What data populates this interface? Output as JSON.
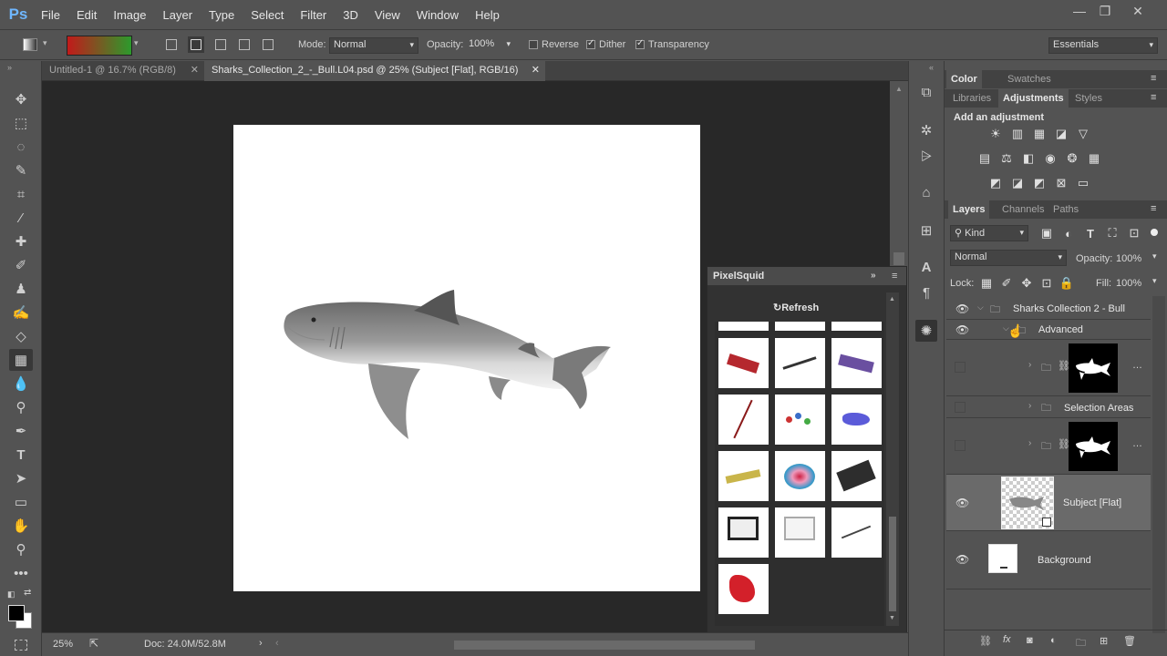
{
  "app": {
    "logo": "Ps",
    "menu": [
      "File",
      "Edit",
      "Image",
      "Layer",
      "Type",
      "Select",
      "Filter",
      "3D",
      "View",
      "Window",
      "Help"
    ],
    "window_controls": [
      "—",
      "❐",
      "✕"
    ]
  },
  "options_bar": {
    "mode_label": "Mode:",
    "mode_value": "Normal",
    "opacity_label": "Opacity:",
    "opacity_value": "100%",
    "reverse_label": "Reverse",
    "reverse_checked": false,
    "dither_label": "Dither",
    "dither_checked": true,
    "transparency_label": "Transparency",
    "transparency_checked": true,
    "workspace_value": "Essentials",
    "gradient_colors": [
      "#c21a1a",
      "#2c9a2c"
    ]
  },
  "tabs": [
    {
      "label": "Untitled-1 @ 16.7% (RGB/8)",
      "active": false
    },
    {
      "label": "Sharks_Collection_2_-_Bull.L04.psd @ 25% (Subject [Flat], RGB/16)",
      "active": true
    }
  ],
  "status": {
    "zoom": "25%",
    "doc": "Doc: 24.0M/52.8M"
  },
  "pixelsquid": {
    "title": "PixelSquid",
    "refresh_label": "Refresh"
  },
  "right_panels": {
    "top_tabs": [
      "Color",
      "Swatches"
    ],
    "mid_tabs": [
      "Libraries",
      "Adjustments",
      "Styles"
    ],
    "adjustment_hint": "Add an adjustment",
    "layer_tabs": [
      "Layers",
      "Channels",
      "Paths"
    ],
    "filter_kind": "Kind",
    "blend_mode": "Normal",
    "opacity_label": "Opacity:",
    "opacity_value": "100%",
    "lock_label": "Lock:",
    "fill_label": "Fill:",
    "fill_value": "100%"
  },
  "layers": [
    {
      "name": "Sharks Collection 2 - Bull",
      "type": "group",
      "visible": true
    },
    {
      "name": "Advanced",
      "type": "group",
      "visible": true
    },
    {
      "name": "",
      "type": "group-mask",
      "visible": false
    },
    {
      "name": "Selection Areas",
      "type": "group",
      "visible": false
    },
    {
      "name": "",
      "type": "group-mask",
      "visible": false
    },
    {
      "name": "Subject [Flat]",
      "type": "smart",
      "visible": true,
      "selected": true
    },
    {
      "name": "Background",
      "type": "layer",
      "visible": true
    }
  ]
}
